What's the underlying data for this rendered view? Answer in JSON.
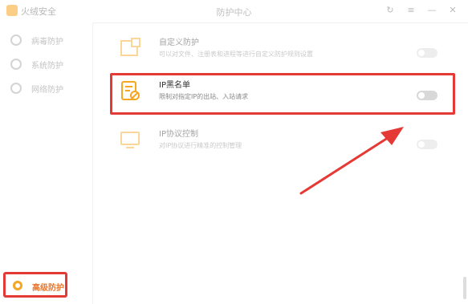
{
  "titlebar": {
    "app_name": "火绒安全",
    "window_title": "防护中心",
    "controls": [
      "↻",
      "≡",
      "—",
      "✕"
    ]
  },
  "sidebar": {
    "items": [
      {
        "label": "病毒防护",
        "icon": "shield-icon"
      },
      {
        "label": "系统防护",
        "icon": "system-icon"
      },
      {
        "label": "网络防护",
        "icon": "network-icon"
      }
    ],
    "active": {
      "label": "高级防护",
      "icon": "advanced-protection-icon"
    }
  },
  "rows": [
    {
      "title": "自定义防护",
      "desc": "可以对文件、注册表和进程等进行自定义防护规则设置",
      "icon": "folder-shield-icon",
      "enabled": false
    },
    {
      "title": "IP黑名单",
      "desc": "限制对指定IP的出站、入站请求",
      "icon": "document-block-icon",
      "enabled": false
    },
    {
      "title": "IP协议控制",
      "desc": "对IP协议进行精准的控制管理",
      "icon": "monitor-icon",
      "enabled": false
    }
  ],
  "colors": {
    "accent": "#f5a623",
    "highlight": "#e53935",
    "active_label": "#e8772e"
  }
}
